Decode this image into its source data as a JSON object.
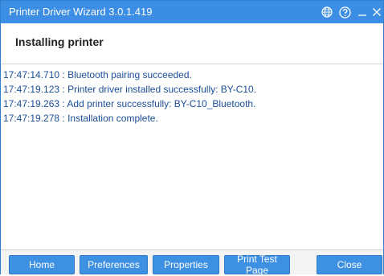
{
  "window": {
    "title": "Printer Driver Wizard  3.0.1.419",
    "icons": [
      "globe-icon",
      "help-icon",
      "minimize-icon",
      "close-icon"
    ]
  },
  "header": {
    "title": "Installing printer"
  },
  "log": {
    "lines": [
      "17:47:14.710 : Bluetooth pairing succeeded.",
      "17:47:19.123 : Printer driver installed successfully: BY-C10.",
      "17:47:19.263 : Add printer successfully: BY-C10_Bluetooth.",
      "17:47:19.278 : Installation complete."
    ]
  },
  "buttons": {
    "home": "Home",
    "preferences": "Preferences",
    "properties": "Properties",
    "print_test_page": "Print Test Page",
    "close": "Close"
  },
  "colors": {
    "titlebar": "#3b8ee3",
    "button": "#3e90e2",
    "log_text": "#1b4f9a"
  }
}
